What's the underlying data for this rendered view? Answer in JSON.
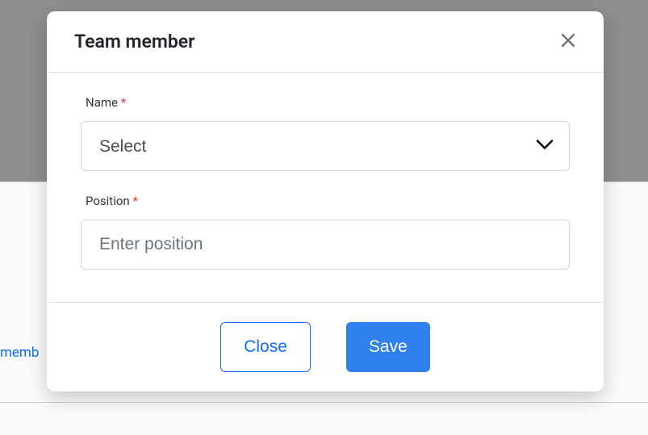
{
  "modal": {
    "title": "Team member",
    "fields": {
      "name": {
        "label": "Name",
        "required_marker": "*",
        "select_placeholder": "Select"
      },
      "position": {
        "label": "Position",
        "required_marker": "*",
        "placeholder": "Enter position",
        "value": ""
      }
    },
    "buttons": {
      "close": "Close",
      "save": "Save"
    }
  },
  "background": {
    "partial_link": "memb"
  }
}
